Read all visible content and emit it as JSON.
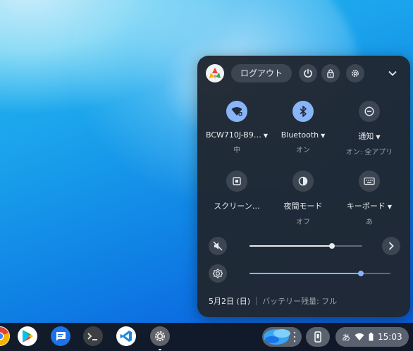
{
  "quick_settings": {
    "logout_label": "ログアウト",
    "icons": {
      "power": "power-icon",
      "lock": "lock-icon",
      "settings": "gear-icon",
      "collapse": "chevron-down-icon"
    },
    "tiles": [
      {
        "name": "wifi",
        "label": "BCW710J-B9…",
        "sub": "中",
        "state": "on",
        "has_menu": true
      },
      {
        "name": "bluetooth",
        "label": "Bluetooth",
        "sub": "オン",
        "state": "on",
        "has_menu": true
      },
      {
        "name": "notifications",
        "label": "通知",
        "sub": "オン: 全アプリ",
        "state": "off",
        "has_menu": true
      },
      {
        "name": "screen-capture",
        "label": "スクリーン…",
        "sub": "",
        "state": "off",
        "has_menu": false
      },
      {
        "name": "night-light",
        "label": "夜間モード",
        "sub": "オフ",
        "state": "off",
        "has_menu": false
      },
      {
        "name": "keyboard",
        "label": "キーボード",
        "sub": "あ",
        "state": "off",
        "has_menu": true
      }
    ],
    "volume": {
      "muted": true,
      "level": 0.73
    },
    "brightness": {
      "level": 0.79
    },
    "date": "5月2日 (日)",
    "battery": "バッテリー残量: フル"
  },
  "shelf": {
    "apps": [
      "chrome",
      "play-store",
      "messages",
      "terminal",
      "vscode",
      "settings"
    ],
    "ime_label": "あ",
    "time": "15:03"
  },
  "colors": {
    "accent": "#8ab4f8",
    "panel_bg": "#202732",
    "button_bg": "#3c4653"
  }
}
